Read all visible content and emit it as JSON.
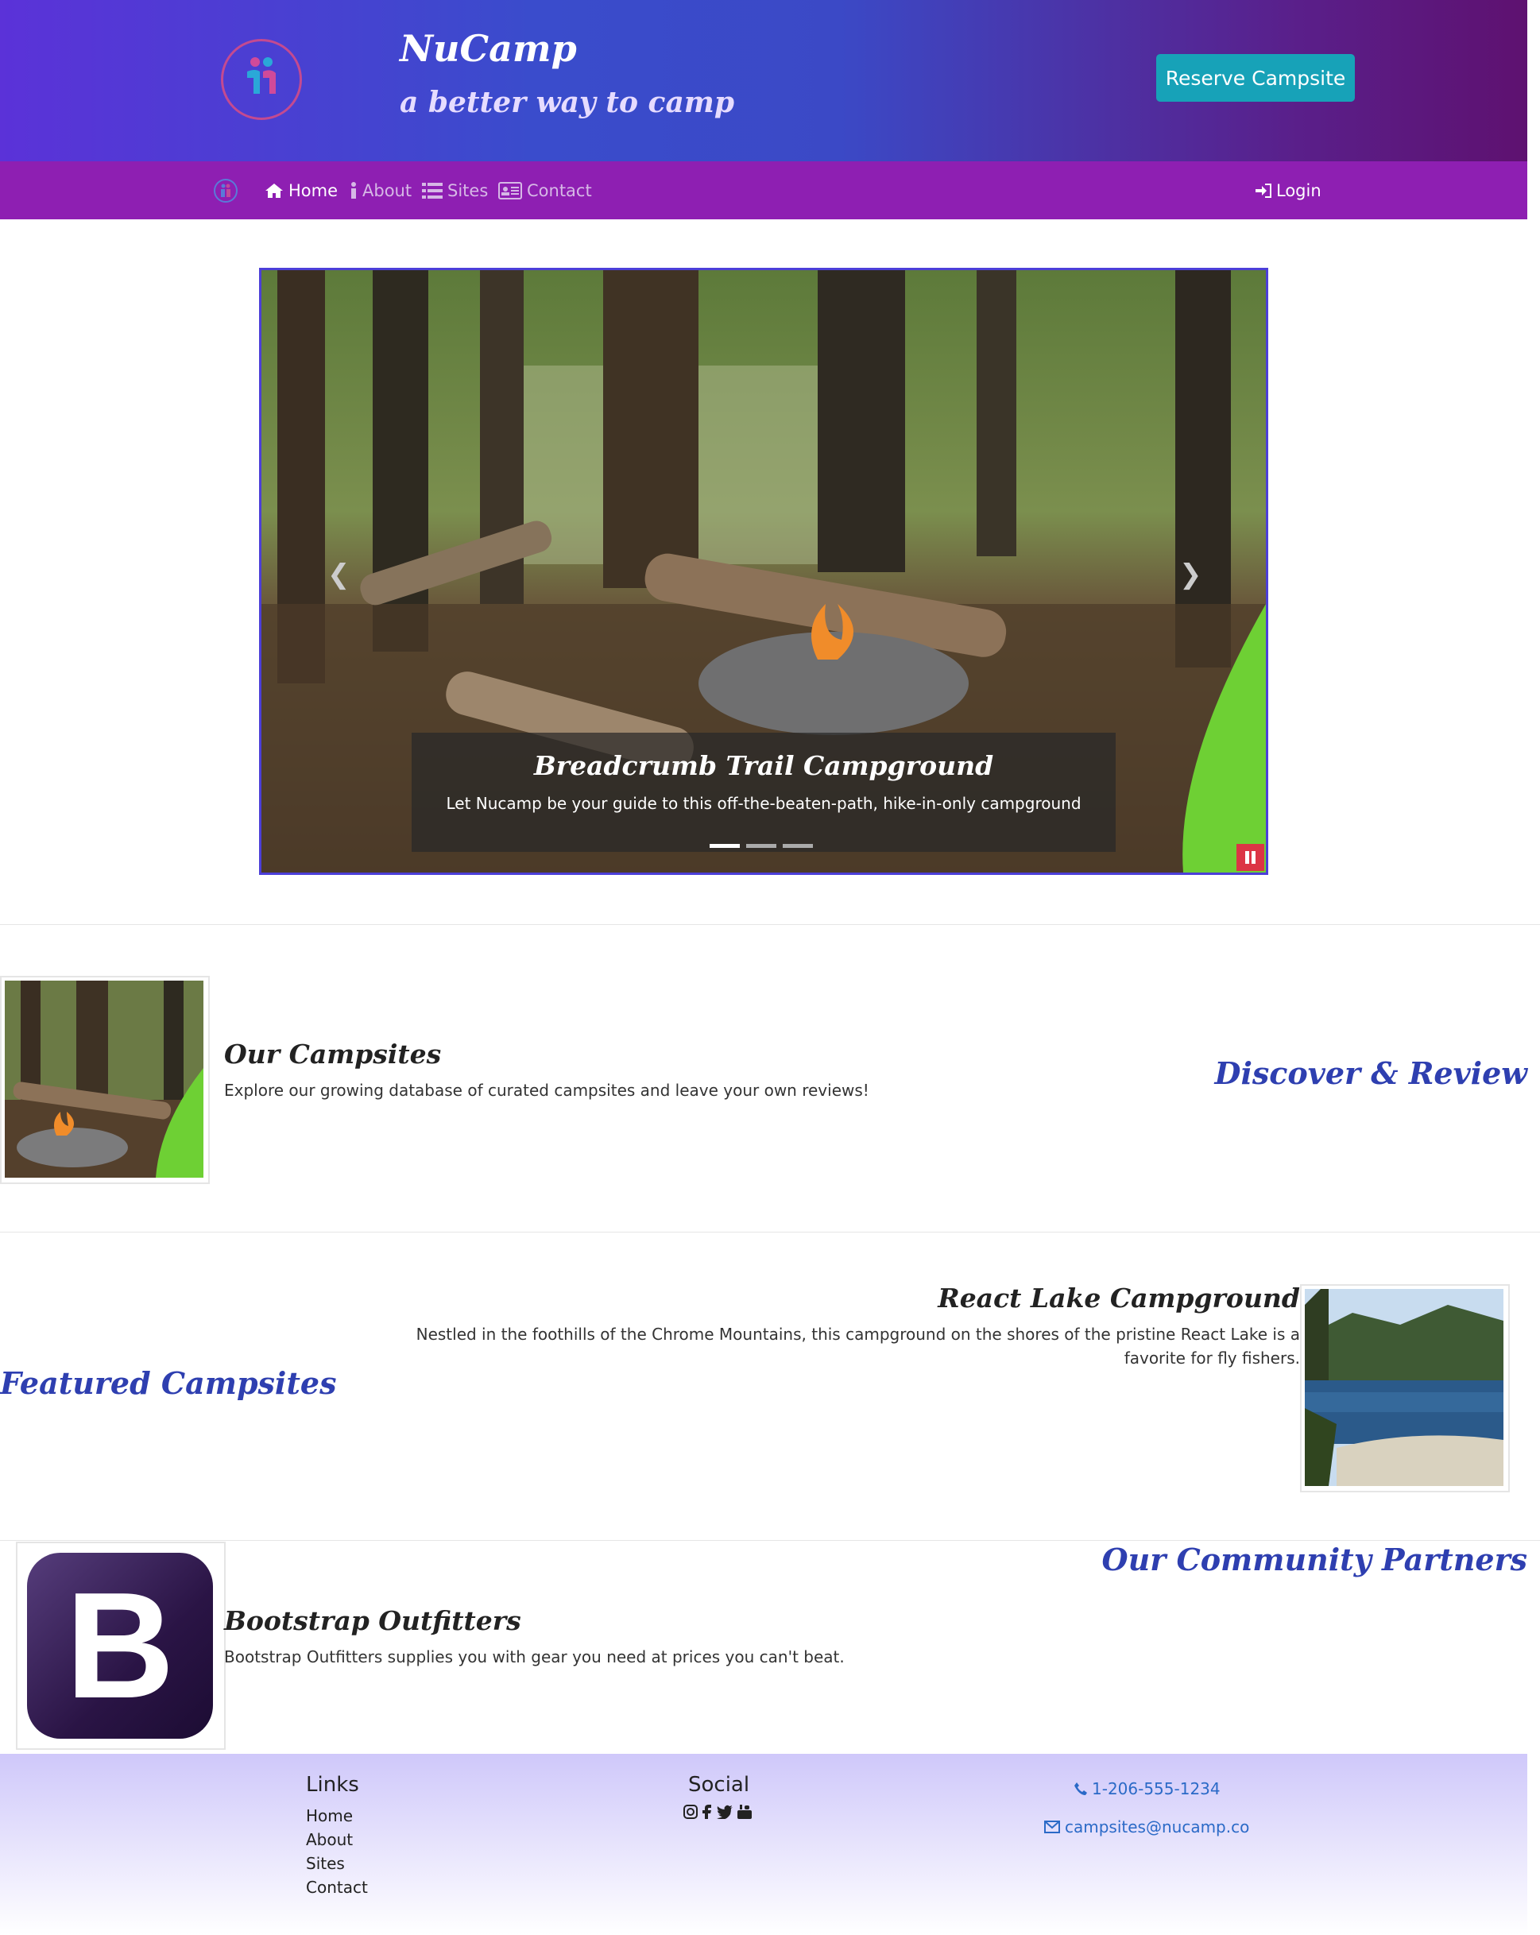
{
  "header": {
    "brand": "NuCamp",
    "tagline": "a better way to camp",
    "reserve_label": "Reserve Campsite"
  },
  "nav": {
    "items": [
      {
        "label": "Home",
        "icon": "home-icon",
        "active": true
      },
      {
        "label": "About",
        "icon": "info-icon",
        "active": false
      },
      {
        "label": "Sites",
        "icon": "list-icon",
        "active": false
      },
      {
        "label": "Contact",
        "icon": "address-card-icon",
        "active": false
      }
    ],
    "login_label": "Login"
  },
  "carousel": {
    "caption_title": "Breadcrumb Trail Campground",
    "caption_text": "Let Nucamp be your guide to this off-the-beaten-path, hike-in-only campground",
    "slide_count": 3,
    "active_index": 0
  },
  "campsites": {
    "title": "Our Campsites",
    "text": "Explore our growing database of curated campsites and leave your own reviews!",
    "side_heading": "Discover & Review"
  },
  "featured": {
    "title": "React Lake Campground",
    "text": "Nestled in the foothills of the Chrome Mountains, this campground on the shores of the pristine React Lake is a favorite for fly fishers.",
    "side_heading": "Featured Campsites"
  },
  "partners": {
    "side_heading": "Our Community Partners",
    "title": "Bootstrap Outfitters",
    "text": "Bootstrap Outfitters supplies you with gear you need at prices you can't beat.",
    "logo_letter": "B"
  },
  "footer": {
    "links_heading": "Links",
    "links": [
      "Home",
      "About",
      "Sites",
      "Contact"
    ],
    "social_heading": "Social",
    "social_icons": [
      "instagram-icon",
      "facebook-icon",
      "twitter-icon",
      "youtube-icon"
    ],
    "phone": "1-206-555-1234",
    "email": "campsites@nucamp.co"
  },
  "colors": {
    "nav_bg": "#8e1fb2",
    "reserve_button": "#17a2b8",
    "accent_heading": "#2e3fb0",
    "pause_button": "#dc3545"
  }
}
